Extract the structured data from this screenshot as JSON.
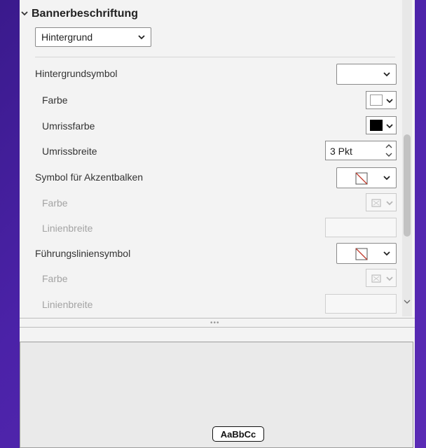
{
  "section": {
    "title": "Bannerbeschriftung"
  },
  "banner_style": {
    "selected": "Hintergrund"
  },
  "rows": {
    "background_symbol": {
      "label": "Hintergrundsymbol"
    },
    "bg_color": {
      "label": "Farbe"
    },
    "outline_color": {
      "label": "Umrissfarbe"
    },
    "outline_width": {
      "label": "Umrissbreite",
      "value": "3 Pkt"
    },
    "accent_bar_symbol": {
      "label": "Symbol für Akzentbalken"
    },
    "accent_color": {
      "label": "Farbe"
    },
    "accent_line_width": {
      "label": "Linienbreite"
    },
    "leader_symbol": {
      "label": "Führungsliniensymbol"
    },
    "leader_color": {
      "label": "Farbe"
    },
    "leader_line_width": {
      "label": "Linienbreite"
    }
  },
  "colors": {
    "bg_fill": "#ffffff",
    "outline_fill": "#000000",
    "background": "#4b22a8",
    "panel": "#f3f3f3"
  },
  "preview": {
    "sample_text": "AaBbCc"
  }
}
